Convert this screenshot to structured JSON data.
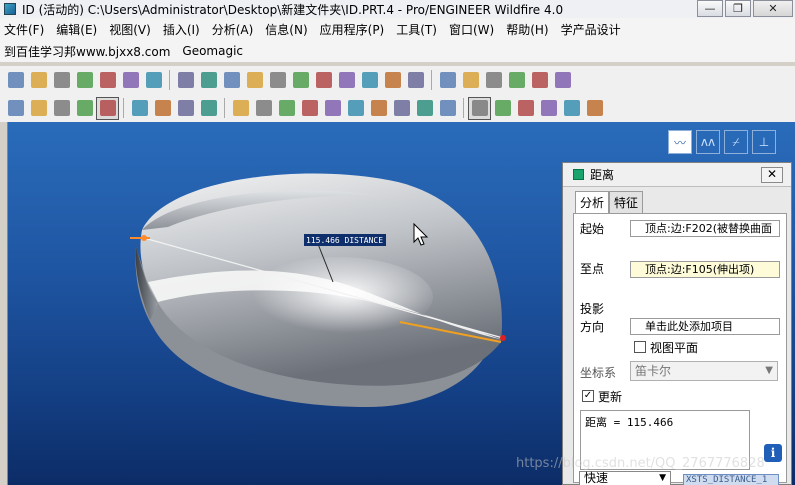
{
  "window": {
    "title": "ID (活动的) C:\\Users\\Administrator\\Desktop\\新建文件夹\\ID.PRT.4 - Pro/ENGINEER Wildfire 4.0",
    "controls": [
      "—",
      "❐",
      "✕"
    ]
  },
  "menu": [
    "文件(F)",
    "编辑(E)",
    "视图(V)",
    "插入(I)",
    "分析(A)",
    "信息(N)",
    "应用程序(P)",
    "工具(T)",
    "窗口(W)",
    "帮助(H)",
    "学产品设计"
  ],
  "menu2": [
    "到百佳学习邦www.bjxx8.com",
    "Geomagic"
  ],
  "toolbar1_icons": [
    "new-icon",
    "open-icon",
    "save-icon",
    "print-icon",
    "send-icon",
    "send2-icon",
    "close-window-icon",
    "sep",
    "regen-icon",
    "undo-icon",
    "redo-icon",
    "cut-icon",
    "copy-icon",
    "paste-icon",
    "paste-special-icon",
    "swap-icon",
    "find-icon",
    "select-box-icon",
    "select-dropdown-icon",
    "sep",
    "layer-icon",
    "view-manager-icon",
    "rename-icon",
    "layers2-icon",
    "appearance-icon",
    "color-icon"
  ],
  "toolbar2_icons": [
    "datum-display-icon",
    "shade-icon",
    "hidden-line-icon",
    "no-hidden-icon",
    "shaded-icon",
    "sep",
    "sketch-icon",
    "axis-icon",
    "point-icon",
    "csys-icon",
    "sep",
    "analysis1-icon",
    "analysis2-icon",
    "analysis3-icon",
    "bulb-icon",
    "globe-icon",
    "teapot-icon",
    "teapot2-icon",
    "save-view-icon",
    "person-icon",
    "tool-icon",
    "sep",
    "measure-icon",
    "analysis-window-icon",
    "palette-icon",
    "render-icon",
    "triangle-icon",
    "box-icon"
  ],
  "graphics": {
    "annotation": "115.466  DISTANCE",
    "mini_tools": [
      "ruler-icon",
      "tube-icon",
      "cut-edge-icon",
      "hide-icon",
      "box-icon"
    ]
  },
  "dialog": {
    "title": "距离",
    "close": "✕",
    "tabs": [
      "分析",
      "特征"
    ],
    "from_label": "起始",
    "from_value": "顶点:边:F202(被替换曲面",
    "to_label": "至点",
    "to_value": "顶点:边:F105(伸出项)",
    "proj_label_1": "投影",
    "proj_label_2": "方向",
    "proj_value": "单击此处添加项目",
    "view_plane_label": "视图平面",
    "csys_label": "坐标系",
    "csys_value": "笛卡尔",
    "update_label": "更新",
    "update_checked": "✓",
    "result_text": "距离 = 115.466",
    "info": "i",
    "mode_value": "快速",
    "feature_chip": "XSTS_DISTANCE_1"
  },
  "watermark": "https://blog.csdn.net/QQ_2767776828"
}
